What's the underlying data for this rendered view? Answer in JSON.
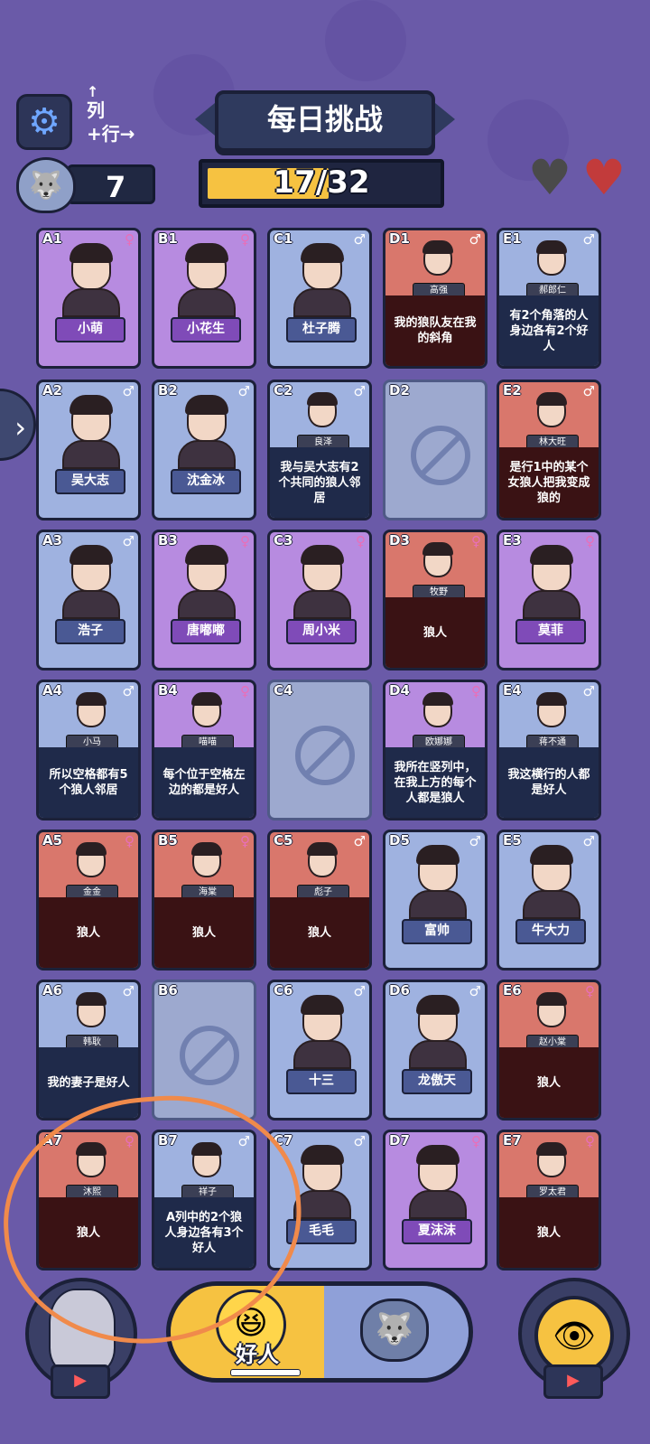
{
  "header": {
    "title": "每日挑战",
    "toggle_col": "列",
    "toggle_row": "行",
    "wolf_count": "7",
    "progress_label": "17/32",
    "progress_fraction": 0.53125,
    "hearts": [
      {
        "state": "empty",
        "color": "#4a4a4a"
      },
      {
        "state": "full",
        "color": "#c23b3b"
      }
    ],
    "gear_icon": "gear-icon"
  },
  "cards": [
    {
      "id": "A1",
      "name": "小萌",
      "type": "female",
      "sex": "female",
      "clue": ""
    },
    {
      "id": "B1",
      "name": "小花生",
      "type": "female",
      "sex": "female",
      "clue": ""
    },
    {
      "id": "C1",
      "name": "杜子腾",
      "type": "innocent",
      "sex": "male",
      "clue": ""
    },
    {
      "id": "D1",
      "name": "高强",
      "type": "wolfcard",
      "sex": "male",
      "clue": "我的狼队友在我的斜角"
    },
    {
      "id": "E1",
      "name": "郝郎仁",
      "type": "innocent",
      "sex": "male",
      "clue": "有2个角落的人身边各有2个好人"
    },
    {
      "id": "A2",
      "name": "吴大志",
      "type": "innocent",
      "sex": "male",
      "clue": ""
    },
    {
      "id": "B2",
      "name": "沈金冰",
      "type": "innocent",
      "sex": "male",
      "clue": ""
    },
    {
      "id": "C2",
      "name": "良泽",
      "type": "innocent",
      "sex": "male",
      "clue": "我与吴大志有2个共同的狼人邻居"
    },
    {
      "id": "D2",
      "name": "",
      "type": "empty",
      "sex": "",
      "clue": ""
    },
    {
      "id": "E2",
      "name": "林大旺",
      "type": "wolfcard",
      "sex": "male",
      "clue": "是行1中的某个女狼人把我变成狼的"
    },
    {
      "id": "A3",
      "name": "浩子",
      "type": "innocent",
      "sex": "male",
      "clue": ""
    },
    {
      "id": "B3",
      "name": "唐嘟嘟",
      "type": "female",
      "sex": "female",
      "clue": ""
    },
    {
      "id": "C3",
      "name": "周小米",
      "type": "female",
      "sex": "female",
      "clue": ""
    },
    {
      "id": "D3",
      "name": "牧野",
      "type": "wolfcard",
      "sex": "female",
      "clue": "狼人"
    },
    {
      "id": "E3",
      "name": "莫菲",
      "type": "female",
      "sex": "female",
      "clue": ""
    },
    {
      "id": "A4",
      "name": "小马",
      "type": "innocent",
      "sex": "male",
      "clue": "所以空格都有5个狼人邻居"
    },
    {
      "id": "B4",
      "name": "喵喵",
      "type": "female",
      "sex": "female",
      "clue": "每个位于空格左边的都是好人"
    },
    {
      "id": "C4",
      "name": "",
      "type": "empty",
      "sex": "",
      "clue": ""
    },
    {
      "id": "D4",
      "name": "欧娜娜",
      "type": "female",
      "sex": "female",
      "clue": "我所在竖列中，在我上方的每个人都是狼人"
    },
    {
      "id": "E4",
      "name": "蒋不通",
      "type": "innocent",
      "sex": "male",
      "clue": "我这横行的人都是好人"
    },
    {
      "id": "A5",
      "name": "金金",
      "type": "wolfcard",
      "sex": "female",
      "clue": "狼人"
    },
    {
      "id": "B5",
      "name": "海棠",
      "type": "wolfcard",
      "sex": "female",
      "clue": "狼人"
    },
    {
      "id": "C5",
      "name": "彪子",
      "type": "wolfcard",
      "sex": "male",
      "clue": "狼人"
    },
    {
      "id": "D5",
      "name": "富帅",
      "type": "innocent",
      "sex": "male",
      "clue": ""
    },
    {
      "id": "E5",
      "name": "牛大力",
      "type": "innocent",
      "sex": "male",
      "clue": ""
    },
    {
      "id": "A6",
      "name": "韩耿",
      "type": "innocent",
      "sex": "male",
      "clue": "我的妻子是好人"
    },
    {
      "id": "B6",
      "name": "",
      "type": "empty",
      "sex": "",
      "clue": ""
    },
    {
      "id": "C6",
      "name": "十三",
      "type": "innocent",
      "sex": "male",
      "clue": ""
    },
    {
      "id": "D6",
      "name": "龙傲天",
      "type": "innocent",
      "sex": "male",
      "clue": ""
    },
    {
      "id": "E6",
      "name": "赵小棠",
      "type": "wolfcard",
      "sex": "female",
      "clue": "狼人"
    },
    {
      "id": "A7",
      "name": "沐熙",
      "type": "wolfcard",
      "sex": "female",
      "clue": "狼人"
    },
    {
      "id": "B7",
      "name": "祥子",
      "type": "innocent",
      "sex": "male",
      "clue": "A列中的2个狼人身边各有3个好人"
    },
    {
      "id": "C7",
      "name": "毛毛",
      "type": "innocent",
      "sex": "male",
      "clue": ""
    },
    {
      "id": "D7",
      "name": "夏沫沫",
      "type": "female",
      "sex": "female",
      "clue": ""
    },
    {
      "id": "E7",
      "name": "罗太君",
      "type": "wolfcard",
      "sex": "female",
      "clue": "狼人"
    }
  ],
  "bottom": {
    "good_label": "好人",
    "left_icon": "old-man-icon",
    "right_icon": "eye-icon",
    "video_icon": "video-camera-icon"
  },
  "colors": {
    "background": "#6a5aa8",
    "innocent": "#9fb2e0",
    "female": "#b78be0",
    "wolf": "#d9776c",
    "accent_yellow": "#f6c241",
    "annotation": "#f08a4b"
  }
}
